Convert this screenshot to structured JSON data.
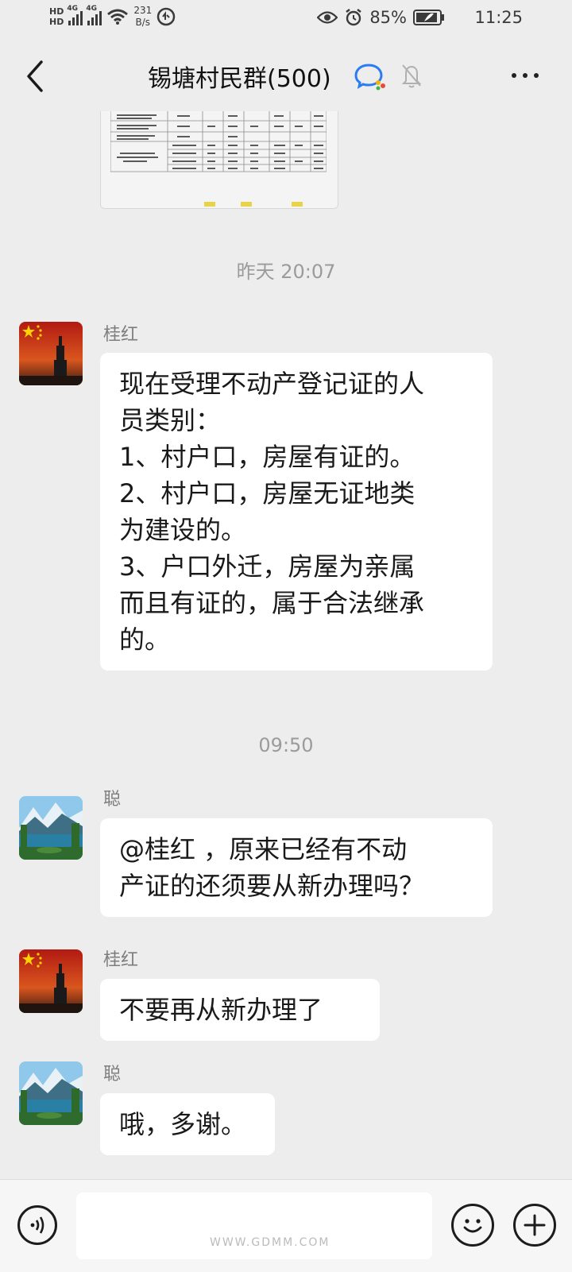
{
  "status_bar": {
    "network_1": "4G",
    "network_2": "4G",
    "speed_value": "231",
    "speed_unit": "B/s",
    "battery": "85%",
    "time": "11:25"
  },
  "header": {
    "title": "锡塘村民群(500)"
  },
  "messages": [
    {
      "timestamp": "昨天 20:07",
      "sender": "桂红",
      "lines": [
        "现在受理不动产登记证的人",
        "员类别：",
        "1、村户口，房屋有证的。",
        "2、村户口，房屋无证地类",
        "为建设的。",
        "3、户口外迁，房屋为亲属",
        "而且有证的，属于合法继承",
        "的。"
      ]
    },
    {
      "timestamp": "09:50",
      "sender": "聪",
      "lines": [
        "@桂红 ，原来已经有不动",
        "产证的还须要从新办理吗？"
      ]
    },
    {
      "sender": "桂红",
      "lines": [
        "不要再从新办理了"
      ]
    },
    {
      "sender": "聪",
      "lines": [
        "哦，多谢。"
      ]
    }
  ],
  "input": {
    "placeholder": ""
  },
  "watermark": "WWW.GDMM.COM",
  "colors": {
    "background": "#ededed",
    "bubble": "#ffffff",
    "timestamp": "#9b9b9b"
  }
}
